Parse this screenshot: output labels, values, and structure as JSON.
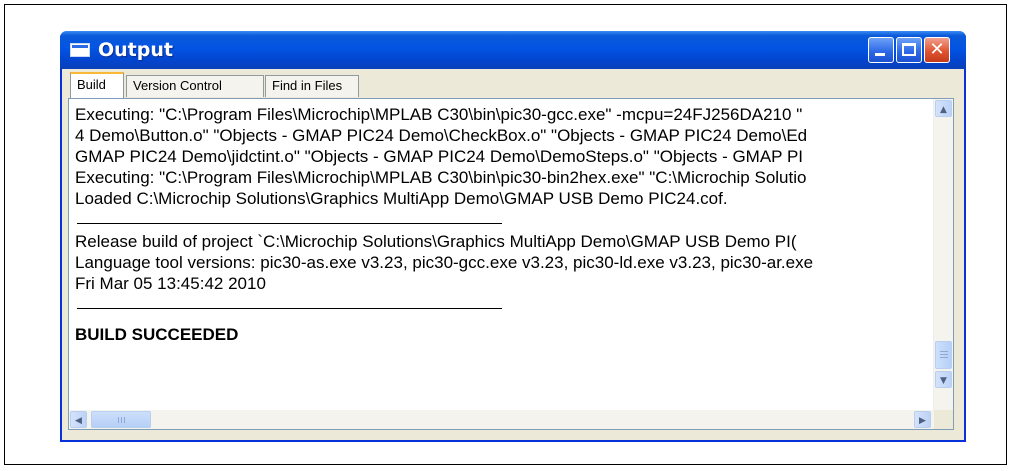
{
  "window": {
    "title": "Output",
    "icon": "output-window-icon",
    "controls": {
      "minimize": "minimize-icon",
      "maximize": "maximize-icon",
      "close": "close-icon",
      "close_glyph": "✕"
    }
  },
  "tabs": [
    {
      "label": "Build",
      "active": true
    },
    {
      "label": "Version Control",
      "active": false
    },
    {
      "label": "Find in Files",
      "active": false
    }
  ],
  "output": {
    "lines": [
      "Executing: \"C:\\Program Files\\Microchip\\MPLAB C30\\bin\\pic30-gcc.exe\" -mcpu=24FJ256DA210 \"",
      "4 Demo\\Button.o\" \"Objects - GMAP PIC24 Demo\\CheckBox.o\" \"Objects - GMAP PIC24 Demo\\Ed",
      "GMAP PIC24 Demo\\jidctint.o\" \"Objects - GMAP PIC24 Demo\\DemoSteps.o\" \"Objects - GMAP PI",
      "Executing: \"C:\\Program Files\\Microchip\\MPLAB C30\\bin\\pic30-bin2hex.exe\" \"C:\\Microchip Solutio",
      "Loaded C:\\Microchip Solutions\\Graphics MultiApp Demo\\GMAP USB Demo PIC24.cof."
    ],
    "release_lines": [
      "Release build of project `C:\\Microchip Solutions\\Graphics MultiApp Demo\\GMAP USB Demo PI(",
      "Language tool versions: pic30-as.exe v3.23, pic30-gcc.exe v3.23, pic30-ld.exe v3.23, pic30-ar.exe",
      "Fri Mar 05 13:45:42 2010"
    ],
    "result": "BUILD SUCCEEDED"
  },
  "scrollbars": {
    "up_arrow": "▲",
    "down_arrow": "▼",
    "left_arrow": "◀",
    "right_arrow": "▶"
  }
}
